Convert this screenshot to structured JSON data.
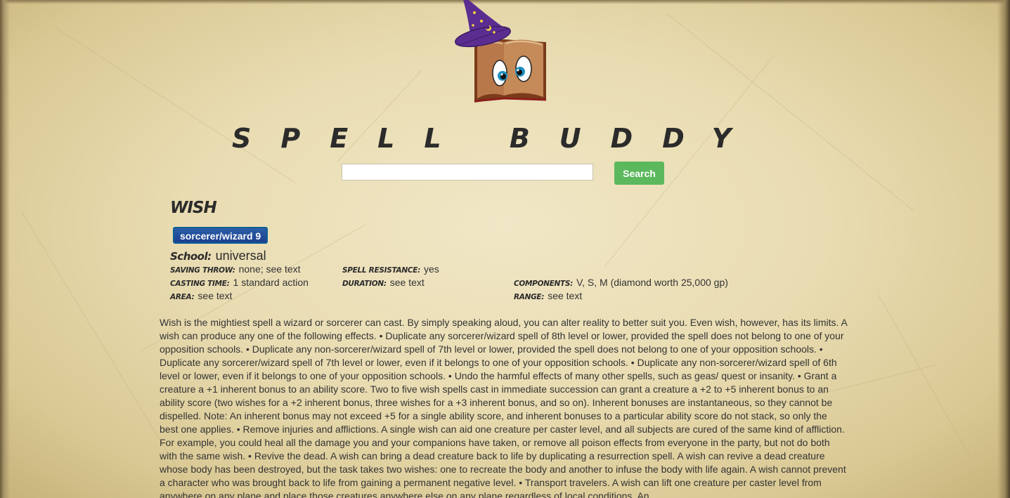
{
  "brand": {
    "title": "SPELL BUDDY",
    "logo_icon": "wizard-book-logo-icon"
  },
  "search": {
    "placeholder": "",
    "value": "",
    "button_label": "Search",
    "button_color": "#5cb85c"
  },
  "spell": {
    "name": "Wish",
    "class_badge": "sorcerer/wizard 9",
    "school_label": "School:",
    "school_value": "universal",
    "stats": {
      "saving_throw_label": "Saving Throw:",
      "saving_throw_value": "none; see text",
      "spell_resistance_label": "Spell Resistance:",
      "spell_resistance_value": "yes",
      "casting_time_label": "Casting Time:",
      "casting_time_value": "1 standard action",
      "duration_label": "Duration:",
      "duration_value": "see text",
      "components_label": "Components:",
      "components_value": "V, S, M (diamond worth 25,000 gp)",
      "area_label": "Area:",
      "area_value": "see text",
      "range_label": "Range:",
      "range_value": "see text"
    },
    "description": "Wish is the mightiest spell a wizard or sorcerer can cast. By simply speaking aloud, you can alter reality to better suit you. Even wish, however, has its limits. A wish can produce any one of the following effects. • Duplicate any sorcerer/wizard spell of 8th level or lower, provided the spell does not belong to one of your opposition schools. • Duplicate any non-sorcerer/wizard spell of 7th level or lower, provided the spell does not belong to one of your opposition schools. • Duplicate any sorcerer/wizard spell of 7th level or lower, even if it belongs to one of your opposition schools. • Duplicate any non-sorcerer/wizard spell of 6th level or lower, even if it belongs to one of your opposition schools. • Undo the harmful effects of many other spells, such as geas/ quest or insanity. • Grant a creature a +1 inherent bonus to an ability score. Two to five wish spells cast in immediate succession can grant a creature a +2 to +5 inherent bonus to an ability score (two wishes for a +2 inherent bonus, three wishes for a +3 inherent bonus, and so on). Inherent bonuses are instantaneous, so they cannot be dispelled. Note: An inherent bonus may not exceed +5 for a single ability score, and inherent bonuses to a particular ability score do not stack, so only the best one applies. • Remove injuries and afflictions. A single wish can aid one creature per caster level, and all subjects are cured of the same kind of affliction. For example, you could heal all the damage you and your companions have taken, or remove all poison effects from everyone in the party, but not do both with the same wish. • Revive the dead. A wish can bring a dead creature back to life by duplicating a resurrection spell. A wish can revive a dead creature whose body has been destroyed, but the task takes two wishes: one to recreate the body and another to infuse the body with life again. A wish cannot prevent a character who was brought back to life from gaining a permanent negative level. • Transport travelers. A wish can lift one creature per caster level from anywhere on any plane and place those creatures anywhere else on any plane regardless of local conditions. An"
  },
  "colors": {
    "badge_bg": "#1d3f8f",
    "badge_border": "#0d5f97",
    "parchment": "#e9dcb2"
  }
}
